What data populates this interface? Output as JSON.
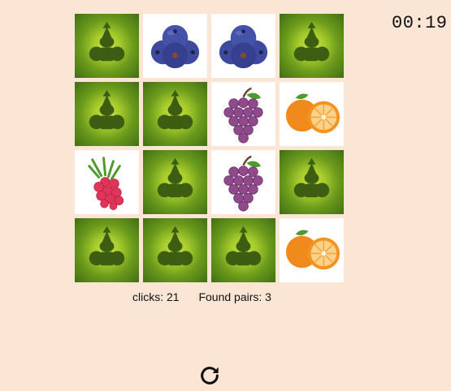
{
  "game": {
    "timer": "00:19",
    "card_back_icon": "fruit-silhouette-icon",
    "grid": [
      [
        "back",
        "blueberry",
        "blueberry",
        "back"
      ],
      [
        "back",
        "back",
        "grapes",
        "orange"
      ],
      [
        "raspberry",
        "back",
        "grapes",
        "back"
      ],
      [
        "back",
        "back",
        "back",
        "orange"
      ]
    ]
  },
  "stats": {
    "clicks_label": "clicks: 21",
    "pairs_label": "Found pairs: 3"
  },
  "controls": {
    "reset_icon": "refresh-icon"
  }
}
